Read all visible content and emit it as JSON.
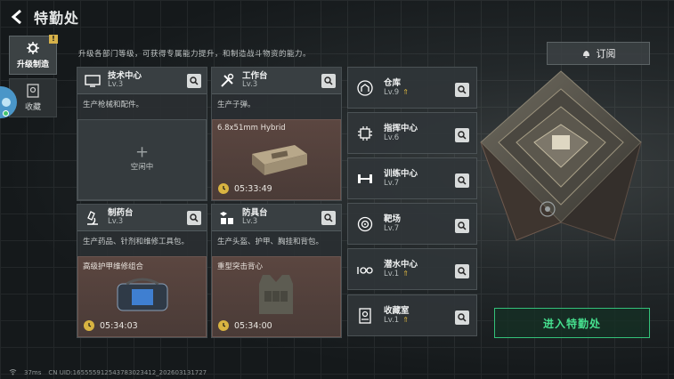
{
  "header": {
    "title": "特勤处"
  },
  "sidebar": {
    "items": [
      {
        "label": "升级制造",
        "badge": "!"
      },
      {
        "label": "收藏"
      }
    ]
  },
  "description": "升级各部门等级，可获得专属能力提升，和制造战斗物资的能力。",
  "subscribe_label": "订阅",
  "cards": {
    "tech": {
      "name": "技术中心",
      "level": "Lv.3",
      "desc": "生产枪械和配件。",
      "slot_label": "空闲中"
    },
    "workbench": {
      "name": "工作台",
      "level": "Lv.3",
      "desc": "生产子弹。",
      "item": "6.8x51mm Hybrid",
      "timer": "05:33:49"
    },
    "pharmacy": {
      "name": "制药台",
      "level": "Lv.3",
      "desc": "生产药品、针剂和维修工具包。",
      "item": "高级护甲维修组合",
      "timer": "05:34:03"
    },
    "armor": {
      "name": "防具台",
      "level": "Lv.3",
      "desc": "生产头盔、护甲、胸挂和背包。",
      "item": "重型突击背心",
      "timer": "05:34:00"
    }
  },
  "rooms": [
    {
      "name": "仓库",
      "level": "Lv.9",
      "upgrade": true
    },
    {
      "name": "指挥中心",
      "level": "Lv.6",
      "upgrade": false
    },
    {
      "name": "训练中心",
      "level": "Lv.7",
      "upgrade": false
    },
    {
      "name": "靶场",
      "level": "Lv.7",
      "upgrade": false
    },
    {
      "name": "潜水中心",
      "level": "Lv.1",
      "upgrade": true
    },
    {
      "name": "收藏室",
      "level": "Lv.1",
      "upgrade": true
    }
  ],
  "enter_button": "进入特勤处",
  "footer": {
    "ping": "37ms",
    "uid": "CN UID:165555912543783023412_202603131727"
  },
  "colors": {
    "accent_green": "#46e08f",
    "gold": "#d9b441",
    "craft_bg": "#5b4640"
  }
}
